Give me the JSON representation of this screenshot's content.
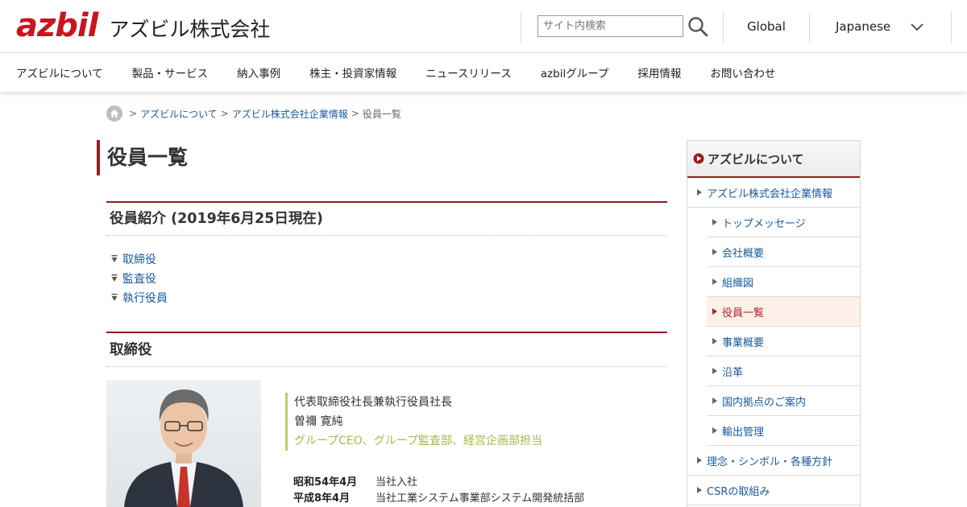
{
  "header": {
    "logo_mark": "azbil",
    "logo_text": "アズビル株式会社",
    "search_placeholder": "サイト内検索",
    "global_label": "Global",
    "language_label": "Japanese"
  },
  "nav": {
    "items": [
      "アズビルについて",
      "製品・サービス",
      "納入事例",
      "株主・投資家情報",
      "ニュースリリース",
      "azbilグループ",
      "採用情報",
      "お問い合わせ"
    ]
  },
  "breadcrumb": {
    "sep": ">",
    "items": [
      "アズビルについて",
      "アズビル株式会社企業情報",
      "役員一覧"
    ]
  },
  "main": {
    "page_title": "役員一覧",
    "section1_title": "役員紹介 (2019年6月25日現在)",
    "anchors": [
      "取締役",
      "監査役",
      "執行役員"
    ],
    "section2_title": "取締役",
    "person": {
      "title": "代表取締役社長兼執行役員社長",
      "name": "曽禰 寛純",
      "responsibility": "グループCEO、グループ監査部、経営企画部担当",
      "career": [
        {
          "date": "昭和54年4月",
          "desc": "当社入社"
        },
        {
          "date": "平成8年4月",
          "desc": "当社工業システム事業部システム開発統括部"
        }
      ]
    }
  },
  "sidebar": {
    "heading": "アズビルについて",
    "items": [
      {
        "label": "アズビル株式会社企業情報",
        "level": 1
      },
      {
        "label": "トップメッセージ",
        "level": 2
      },
      {
        "label": "会社概要",
        "level": 2
      },
      {
        "label": "組織図",
        "level": 2
      },
      {
        "label": "役員一覧",
        "level": 2,
        "active": true
      },
      {
        "label": "事業概要",
        "level": 2
      },
      {
        "label": "沿革",
        "level": 2
      },
      {
        "label": "国内拠点のご案内",
        "level": 2
      },
      {
        "label": "輸出管理",
        "level": 2
      },
      {
        "label": "理念・シンボル・各種方針",
        "level": 1
      },
      {
        "label": "CSRの取組み",
        "level": 1
      }
    ]
  },
  "colors": {
    "brand_red": "#c8161d",
    "accent_dark_red": "#9b1b1e",
    "link_blue": "#1a5a9a",
    "responsibility_green": "#a8b84a"
  }
}
